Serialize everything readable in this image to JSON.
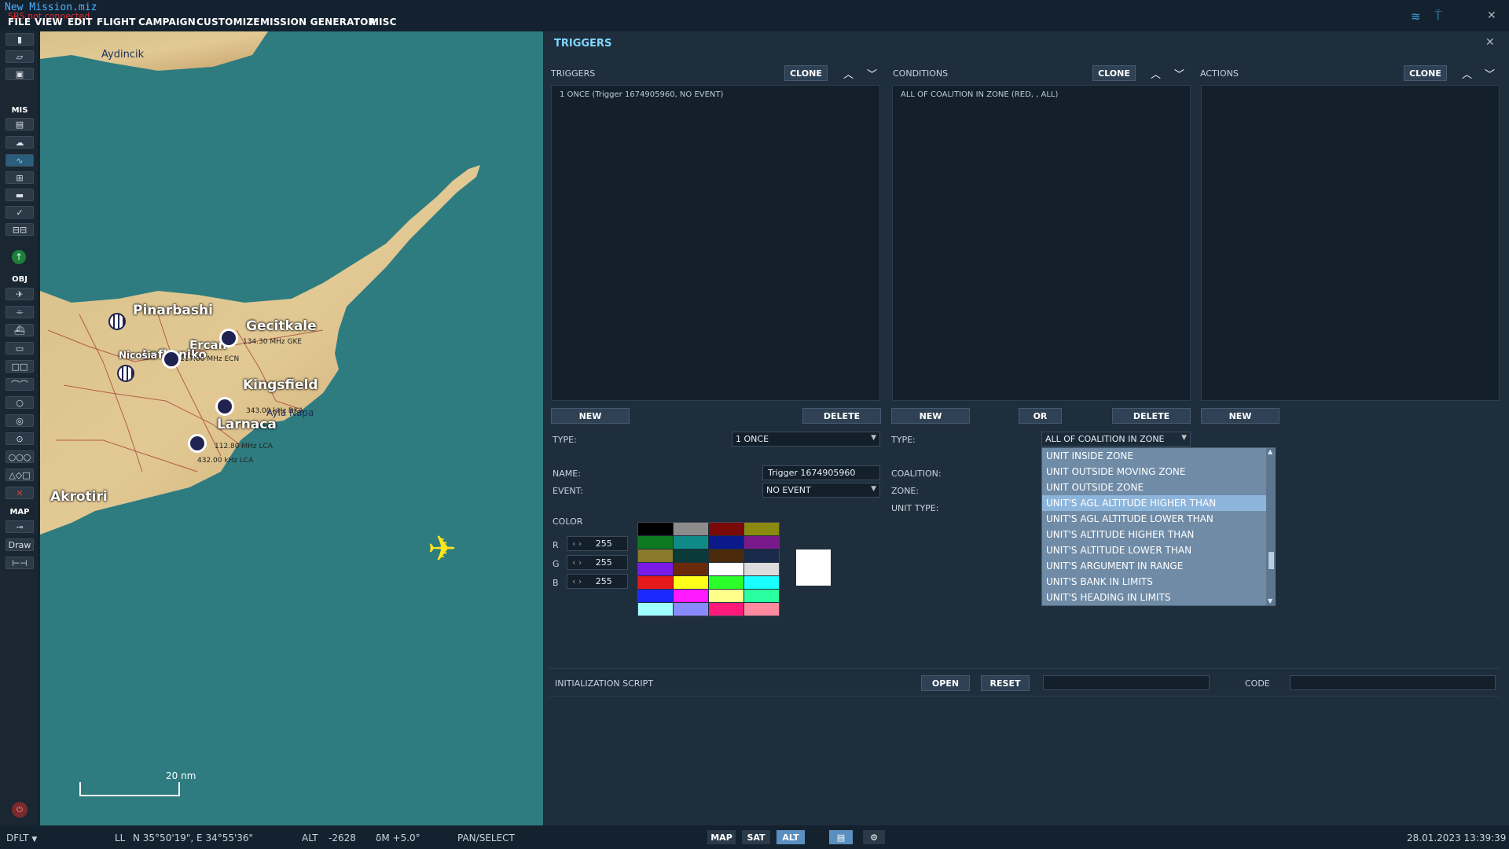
{
  "header": {
    "file_title": "New Mission.miz",
    "srs_status": "SRS not connected",
    "menu": [
      "FILE",
      "VIEW",
      "EDIT",
      "FLIGHT",
      "CAMPAIGN",
      "CUSTOMIZE",
      "MISSION GENERATOR",
      "MISC"
    ]
  },
  "toolbar": {
    "sections": {
      "mis": "MIS",
      "obj": "OBJ",
      "map": "MAP"
    },
    "draw_label": "Draw"
  },
  "map": {
    "places": [
      "Aydincik",
      "Pinarbashi",
      "Gecitkale",
      "Ercan",
      "Lefkoniko",
      "Nicosia",
      "Kingsfield",
      "Larnaca",
      "Ayia Napa",
      "Akrotiri"
    ],
    "frequencies": [
      "134.30 MHz GKE",
      "112.80 MHz LCA",
      "432.00 kHz LCA",
      "343.00 kHz DKA",
      "117.00 MHz ECN"
    ],
    "scale": "20 nm"
  },
  "panel": {
    "title": "TRIGGERS",
    "columns": {
      "triggers": "TRIGGERS",
      "conditions": "CONDITIONS",
      "actions": "ACTIONS"
    },
    "clone_label": "CLONE",
    "new_label": "NEW",
    "delete_label": "DELETE",
    "or_label": "OR",
    "trigger_row": "1 ONCE (Trigger 1674905960, NO EVENT)",
    "condition_row": "ALL OF COALITION IN ZONE (RED, , ALL)",
    "labels": {
      "type": "TYPE:",
      "name": "NAME:",
      "event": "EVENT:",
      "color": "COLOR",
      "r": "R",
      "g": "G",
      "b": "B",
      "coalition": "COALITION:",
      "zone": "ZONE:",
      "unit_type": "UNIT TYPE:"
    },
    "trigger_type": "1 ONCE",
    "trigger_name": "Trigger 1674905960",
    "trigger_event": "NO EVENT",
    "rgb": {
      "r": "255",
      "g": "255",
      "b": "255"
    },
    "condition_type": "ALL OF COALITION IN ZONE",
    "dropdown_options": [
      "UNIT INSIDE ZONE",
      "UNIT OUTSIDE MOVING ZONE",
      "UNIT OUTSIDE ZONE",
      "UNIT'S AGL ALTITUDE HIGHER THAN",
      "UNIT'S AGL ALTITUDE LOWER THAN",
      "UNIT'S ALTITUDE HIGHER THAN",
      "UNIT'S ALTITUDE LOWER THAN",
      "UNIT'S ARGUMENT IN RANGE",
      "UNIT'S BANK IN LIMITS",
      "UNIT'S HEADING IN LIMITS"
    ],
    "selected_option_index": 3,
    "swatch_colors": [
      "#000000",
      "#8c8c8c",
      "#7a0a0a",
      "#8a8a10",
      "#0d7a22",
      "#0f8a86",
      "#0a1a8a",
      "#7a1a8a",
      "#8a7a2a",
      "#0a3a3a",
      "#4a2a0a",
      "#1a2a4a",
      "#7a1ae6",
      "#6a2a0a",
      "#ffffff",
      "#dcdcdc",
      "#e61a1a",
      "#ffff1a",
      "#2aff2a",
      "#1affff",
      "#1a2aff",
      "#ff1aff",
      "#ffff8a",
      "#2affa0",
      "#a0ffff",
      "#8a8aff",
      "#ff1a7a",
      "#ff8aa0"
    ],
    "init_script_label": "INITIALIZATION SCRIPT",
    "open_label": "OPEN",
    "reset_label": "RESET",
    "code_label": "CODE"
  },
  "status": {
    "profile": "DFLT",
    "coord_mode": "LL",
    "coords": "N 35°50'19\", E 34°55'36\"",
    "alt_label": "ALT",
    "alt_value": "-2628",
    "magvar": "δM  +5.0°",
    "mode": "PAN/SELECT",
    "map_btn": "MAP",
    "sat_btn": "SAT",
    "alt_btn": "ALT",
    "datetime": "28.01.2023 13:39:39"
  }
}
